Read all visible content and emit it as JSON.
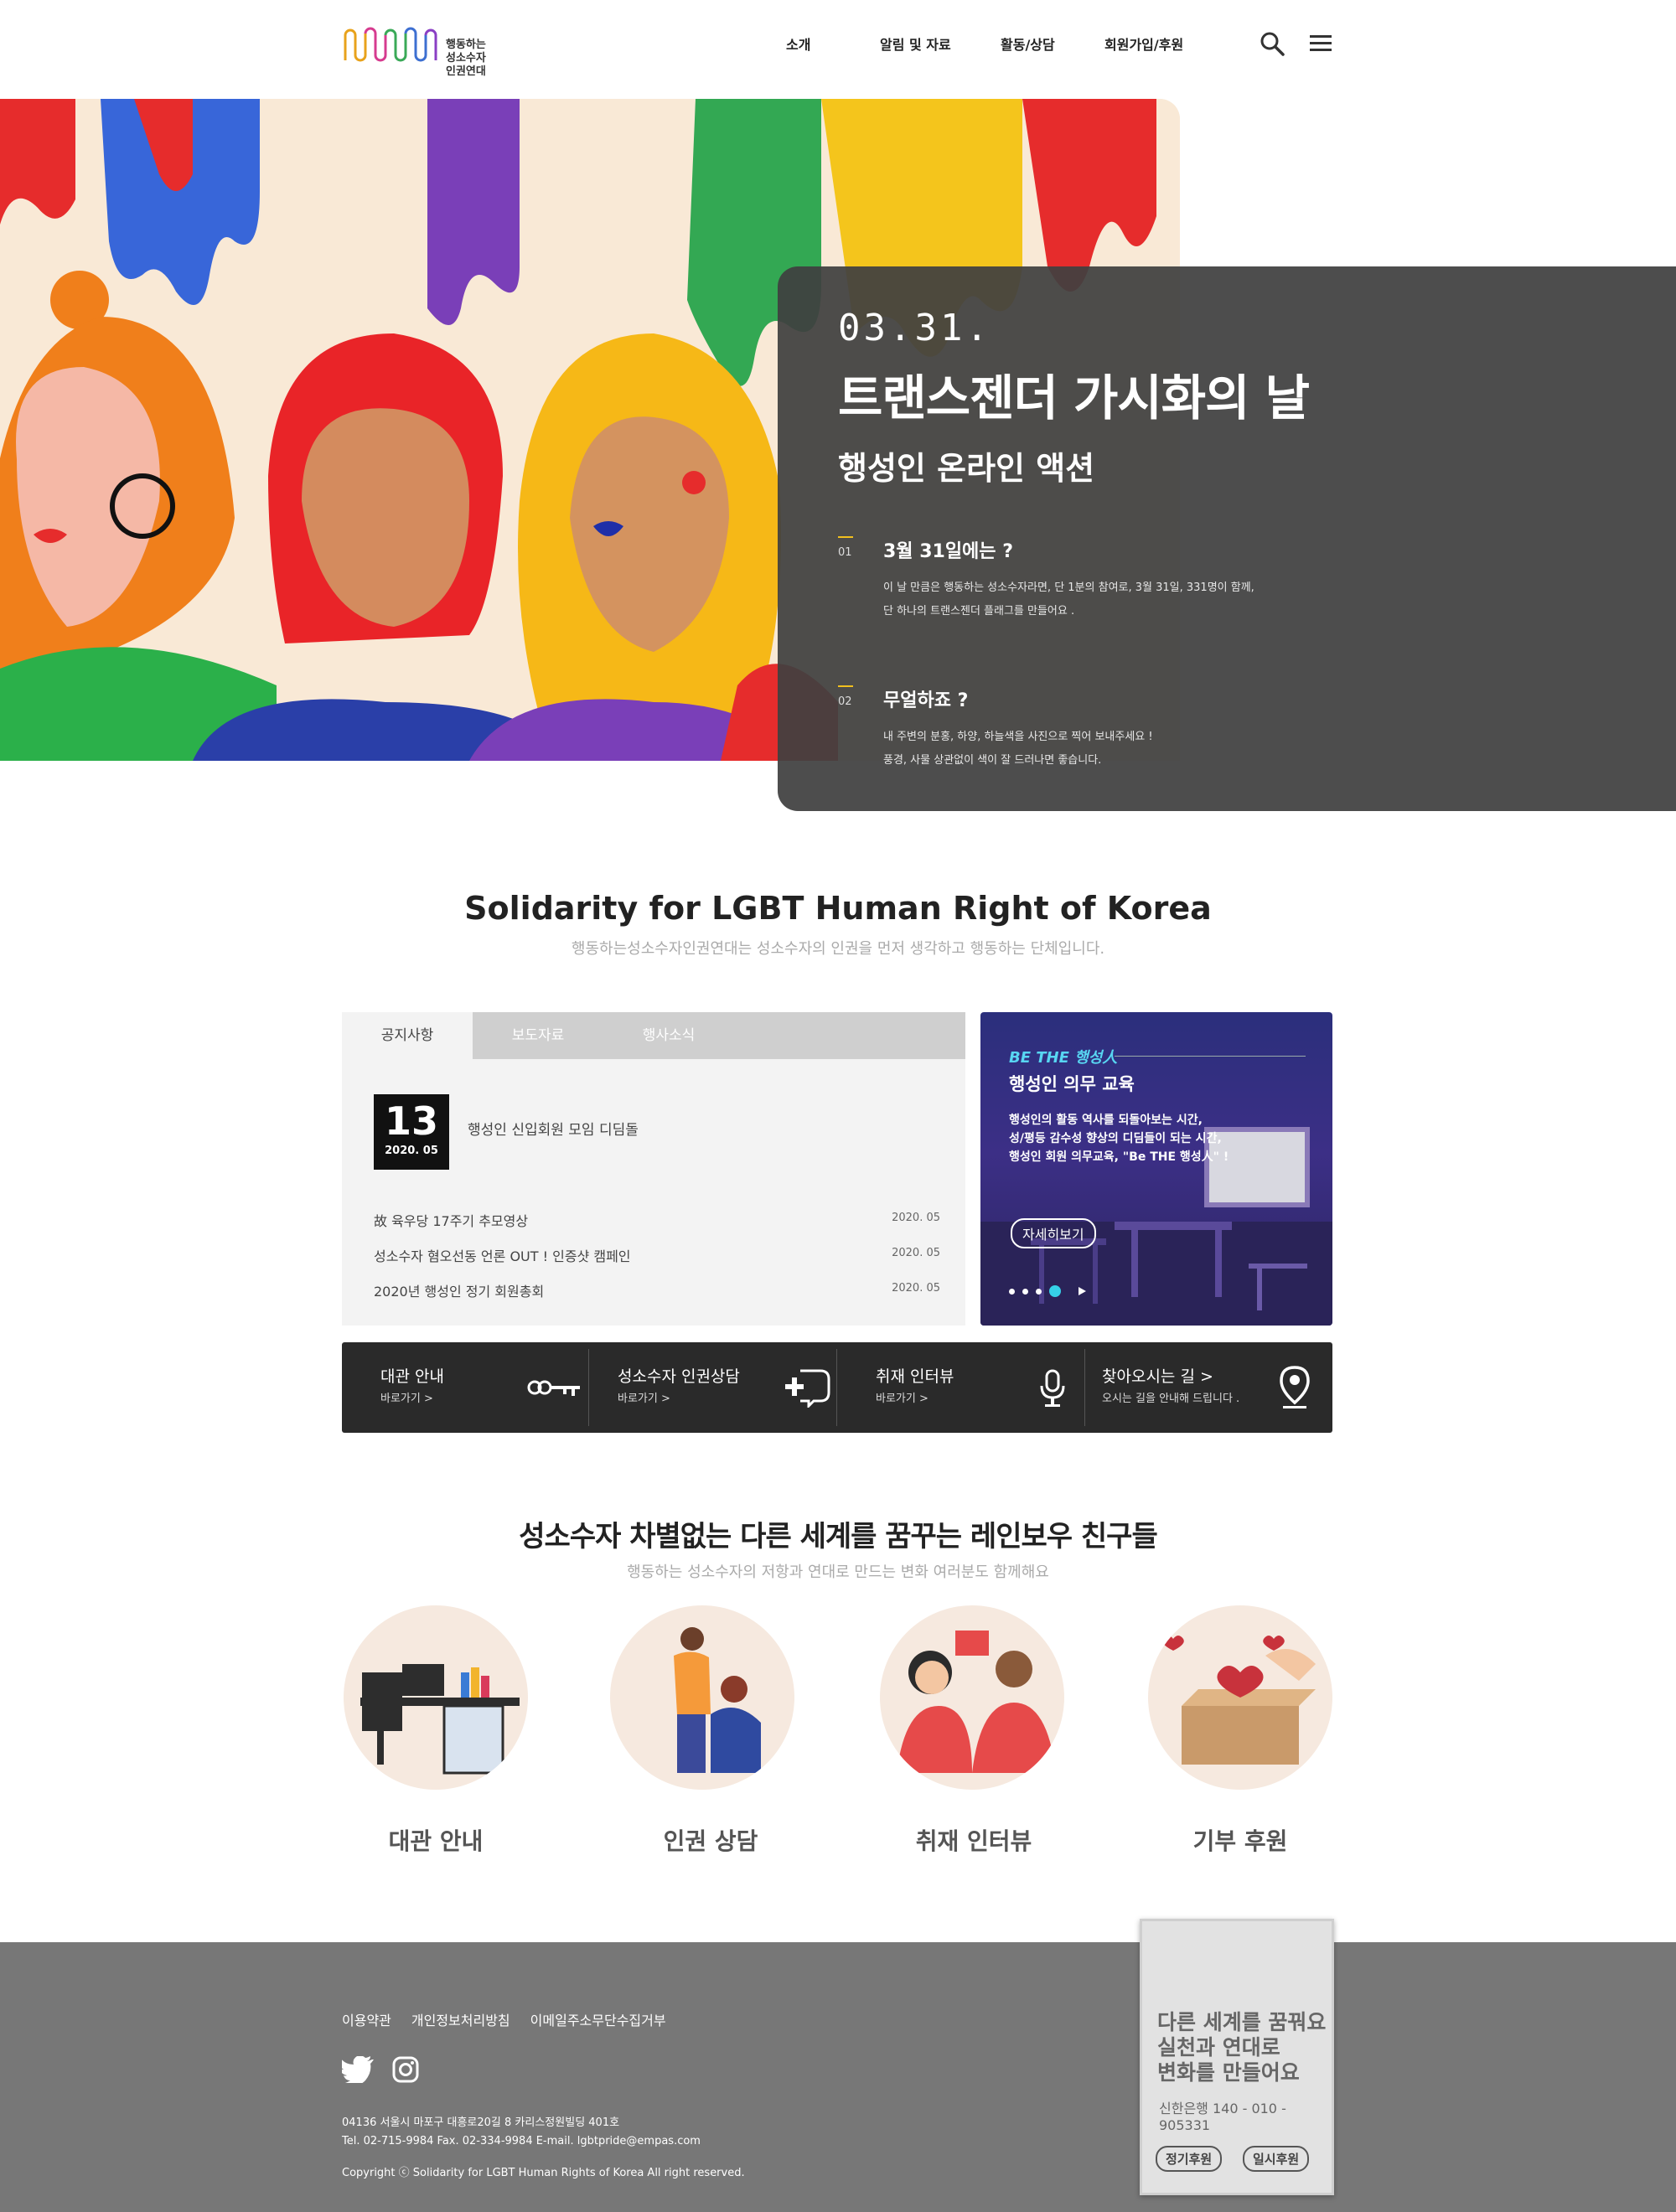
{
  "header": {
    "logo_text": [
      "행동하는",
      "성소수자",
      "인권연대"
    ],
    "nav": [
      "소개",
      "알림 및 자료",
      "활동/상담",
      "회원가입/후원"
    ]
  },
  "hero": {
    "date": "03.31.",
    "title": "트랜스젠더 가시화의 날",
    "subtitle": "행성인 온라인 액션",
    "items": [
      {
        "num": "01",
        "title": "3월 31일에는 ?",
        "desc": [
          "이 날 만큼은 행동하는 성소수자라면, 단 1분의 참여로, 3월 31일, 331명이 함께,",
          "단 하나의 트랜스젠더 플래그를 만들어요 ."
        ]
      },
      {
        "num": "02",
        "title": "무얼하죠 ?",
        "desc": [
          "내 주변의 분홍, 하양, 하늘색을 사진으로 찍어 보내주세요 !",
          "풍경, 사물 상관없이 색이 잘 드러나면 좋습니다."
        ]
      }
    ]
  },
  "intro": {
    "title": "Solidarity for LGBT Human Right of Korea",
    "subtitle": "행동하는성소수자인권연대는 성소수자의 인권을 먼저 생각하고 행동하는 단체입니다."
  },
  "board": {
    "tabs": [
      "공지사항",
      "보도자료",
      "행사소식"
    ],
    "featured": {
      "day": "13",
      "ym": "2020. 05",
      "title": "행성인 신입회원 모임 디딤돌"
    },
    "rows": [
      {
        "title": "故 육우당 17주기 추모영상",
        "date": "2020. 05"
      },
      {
        "title": "성소수자 혐오선동 언론 OUT ! 인증샷 캠페인",
        "date": "2020. 05"
      },
      {
        "title": "2020년 행성인 정기 회원총회",
        "date": "2020. 05"
      }
    ]
  },
  "banner": {
    "kicker": "BE THE 행성人",
    "title": "행성인 의무 교육",
    "desc": [
      "행성인의 활동 역사를 되돌아보는 시간,",
      "성/평등 감수성 향상의 디딤들이 되는 시간,",
      "행성인 회원 의무교육, \"Be THE 행성人\" !"
    ],
    "more": "자세히보기"
  },
  "quick": [
    {
      "title": "대관 안내",
      "sub": "바로가기 >"
    },
    {
      "title": "성소수자 인권상담",
      "sub": "바로가기 >"
    },
    {
      "title": "취재 인터뷰",
      "sub": "바로가기 >"
    },
    {
      "title": "찾아오시는 길  >",
      "sub": "오시는 길을 안내해 드립니다 ."
    }
  ],
  "friends": {
    "title": "성소수자 차별없는  다른 세계를 꿈꾸는 레인보우 친구들",
    "subtitle": "행동하는 성소수자의 저항과 연대로 만드는 변화 여러분도 함께해요",
    "items": [
      "대관 안내",
      "인권 상담",
      "취재 인터뷰",
      "기부 후원"
    ]
  },
  "footer": {
    "links": [
      "이용약관",
      "개인정보처리방침",
      "이메일주소무단수집거부"
    ],
    "address": "04136 서울시 마포구 대흥로20길 8 카리스정원빌딩 401호",
    "contact": "Tel. 02-715-9984 Fax. 02-334-9984 E-mail. lgbtpride@empas.com",
    "copyright": "Copyright ⓒ Solidarity for LGBT Human Rights of Korea All right reserved."
  },
  "donate": {
    "message": [
      "다른 세계를 꿈꿔요",
      "실천과 연대로",
      "변화를 만들어요"
    ],
    "account": "신한은행 140 - 010 - 905331",
    "regular": "정기후원",
    "once": "일시후원"
  },
  "colors": {
    "hero_panel": "#404040",
    "accent": "#36d1e8",
    "footer": "#777777",
    "dash": "#f2c01e"
  }
}
